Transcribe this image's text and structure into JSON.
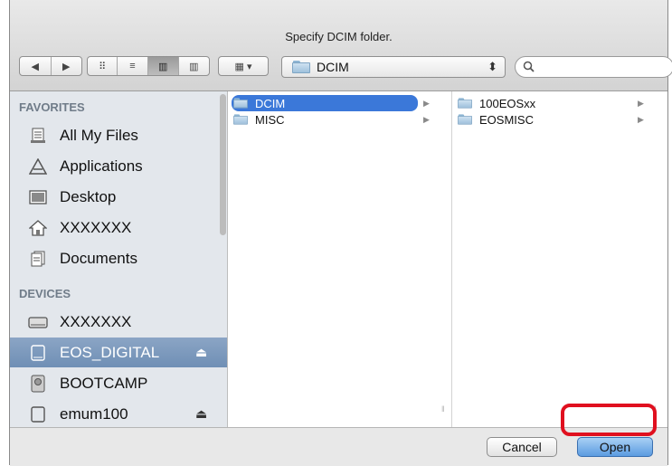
{
  "dialog": {
    "title": "Specify DCIM folder."
  },
  "toolbar": {
    "back_label": "◀",
    "forward_label": "▶",
    "view_icons_label": "⠿",
    "view_list_label": "≡",
    "view_columns_label": "▥",
    "view_coverflow_label": "▥",
    "arrange_label": "▦ ▾",
    "location": "DCIM",
    "location_arrows": "⬍",
    "search_placeholder": ""
  },
  "sidebar": {
    "favorites_header": "FAVORITES",
    "devices_header": "DEVICES",
    "favorites": [
      {
        "label": "All My Files",
        "icon": "all-files-icon"
      },
      {
        "label": "Applications",
        "icon": "applications-icon"
      },
      {
        "label": "Desktop",
        "icon": "desktop-icon"
      },
      {
        "label": "XXXXXXX",
        "icon": "home-icon"
      },
      {
        "label": "Documents",
        "icon": "documents-icon"
      }
    ],
    "devices": [
      {
        "label": "XXXXXXX",
        "icon": "hard-drive-icon"
      },
      {
        "label": "EOS_DIGITAL",
        "icon": "removable-drive-icon",
        "eject": "⏏",
        "selected": true
      },
      {
        "label": "BOOTCAMP",
        "icon": "disk-icon"
      },
      {
        "label": "emum100",
        "icon": "removable-drive-icon",
        "eject": "⏏"
      }
    ]
  },
  "columns": [
    {
      "items": [
        {
          "label": "DCIM",
          "selected": true
        },
        {
          "label": "MISC"
        }
      ]
    },
    {
      "items": [
        {
          "label": "100EOSxx"
        },
        {
          "label": "EOSMISC"
        }
      ]
    }
  ],
  "footer": {
    "cancel_label": "Cancel",
    "open_label": "Open"
  },
  "colors": {
    "highlight_ring": "#e0101f",
    "selection": "#3b78d9",
    "sidebar_selection": "#7c9cc0"
  }
}
